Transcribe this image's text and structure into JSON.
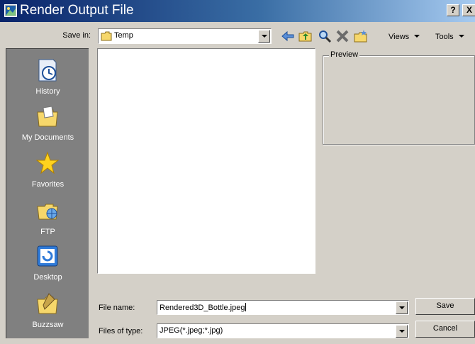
{
  "window": {
    "title": "Render Output File",
    "help_label": "?",
    "close_label": "X"
  },
  "toolbar": {
    "save_in_label": "Save in:",
    "save_in_value": "Temp",
    "views_label": "Views",
    "tools_label": "Tools"
  },
  "places": [
    {
      "label": "History",
      "icon": "history-icon"
    },
    {
      "label": "My Documents",
      "icon": "my-documents-icon"
    },
    {
      "label": "Favorites",
      "icon": "favorites-icon"
    },
    {
      "label": "FTP",
      "icon": "ftp-icon"
    },
    {
      "label": "Desktop",
      "icon": "desktop-icon"
    },
    {
      "label": "Buzzsaw",
      "icon": "buzzsaw-icon"
    }
  ],
  "preview": {
    "label": "Preview"
  },
  "form": {
    "file_name_label": "File name:",
    "file_name_value": "Rendered3D_Bottle.jpeg",
    "file_type_label": "Files of type:",
    "file_type_value": "JPEG(*.jpeg;*.jpg)"
  },
  "buttons": {
    "save_label": "Save",
    "cancel_label": "Cancel"
  }
}
